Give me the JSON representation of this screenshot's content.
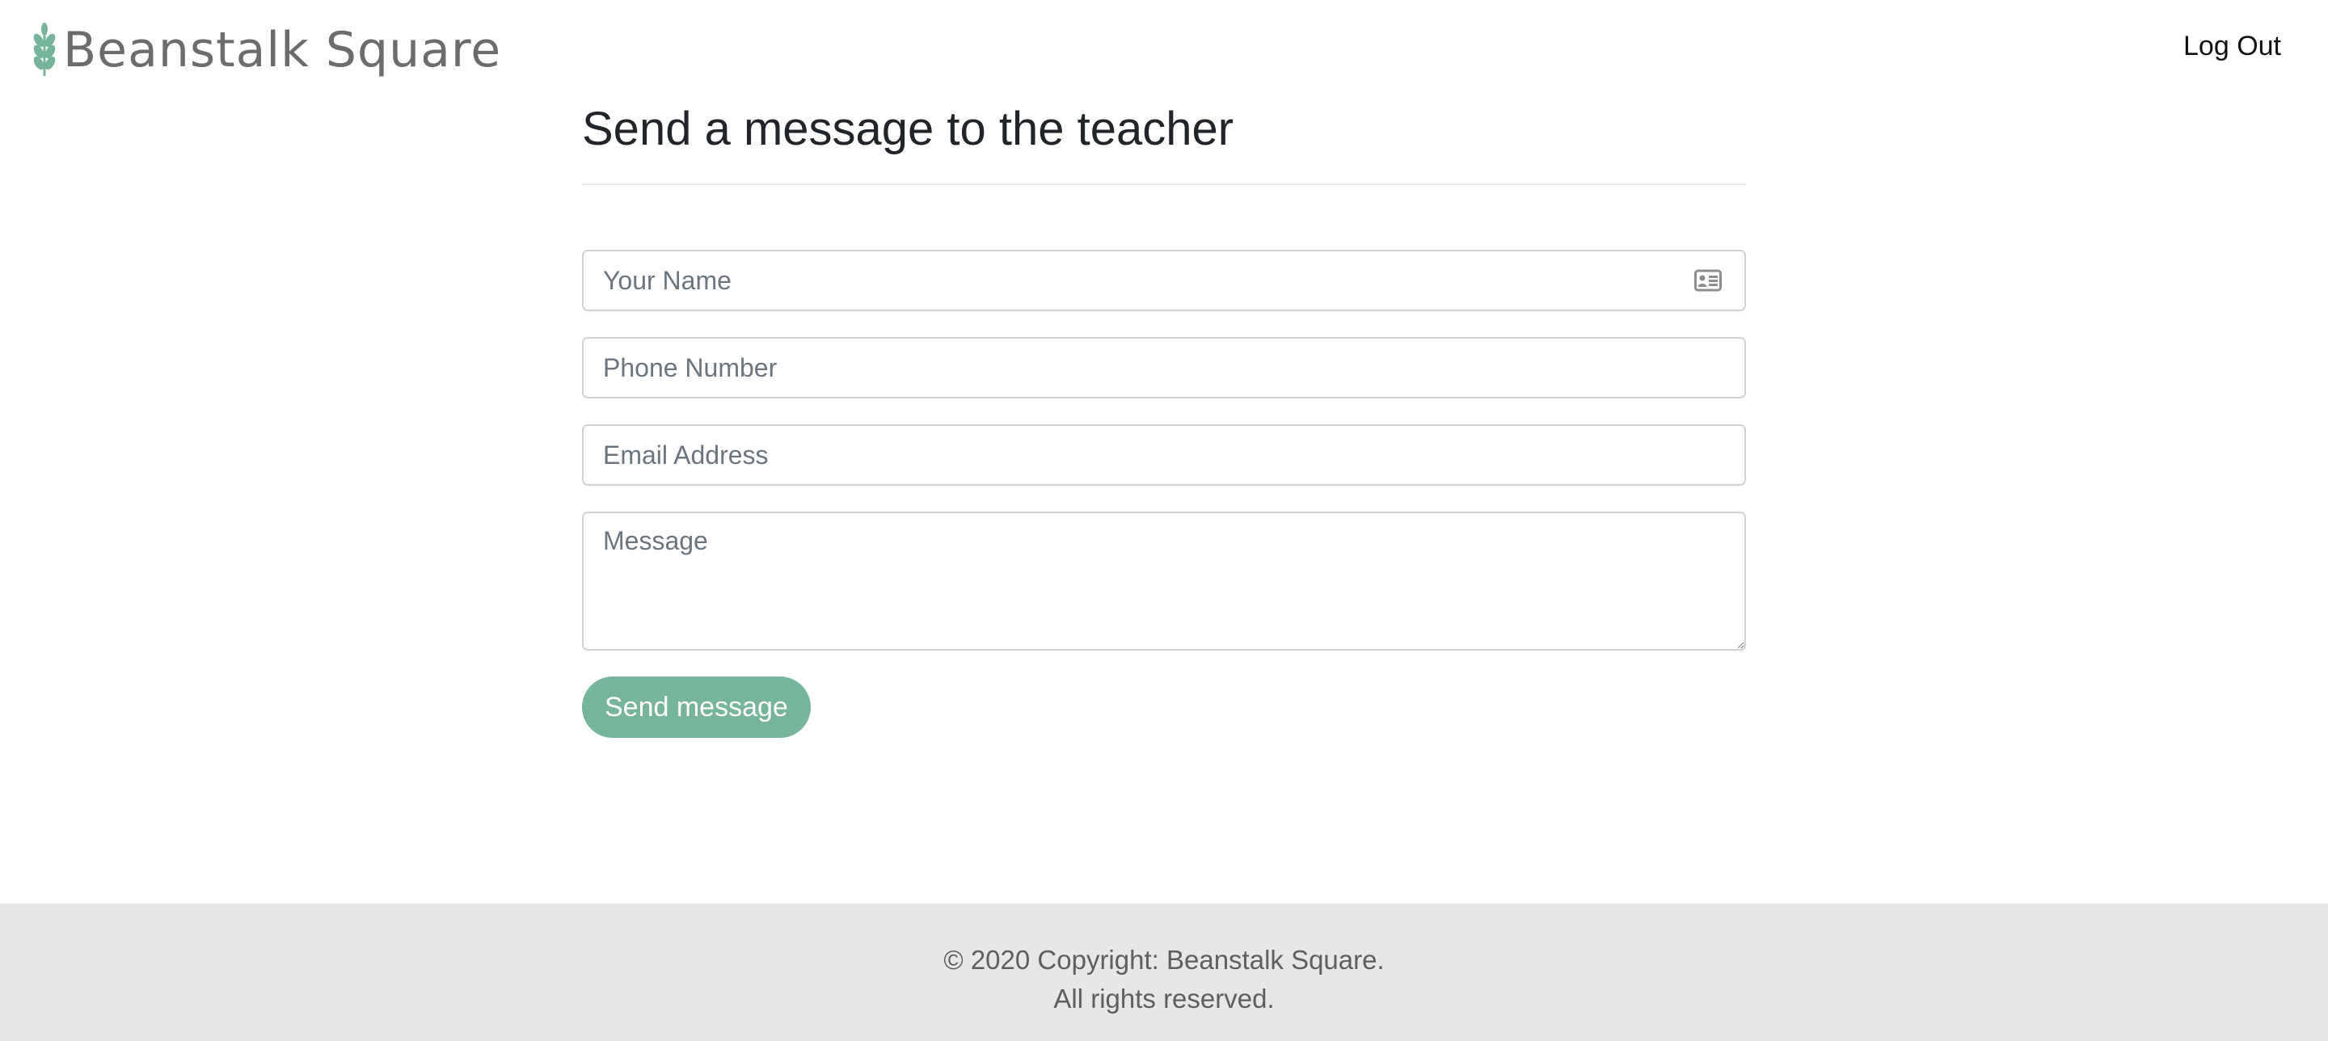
{
  "header": {
    "brand_name": "Beanstalk Square",
    "logo_icon": "wheat-sprig-icon",
    "brand_color": "#76b49c",
    "logout_label": "Log Out"
  },
  "main": {
    "title": "Send a message to the teacher",
    "form": {
      "name_placeholder": "Your Name",
      "name_icon": "contact-card-icon",
      "phone_placeholder": "Phone Number",
      "email_placeholder": "Email Address",
      "message_placeholder": "Message",
      "submit_label": "Send message"
    }
  },
  "footer": {
    "copyright_line": "© 2020 Copyright: Beanstalk Square.",
    "rights_line": "All rights reserved."
  }
}
